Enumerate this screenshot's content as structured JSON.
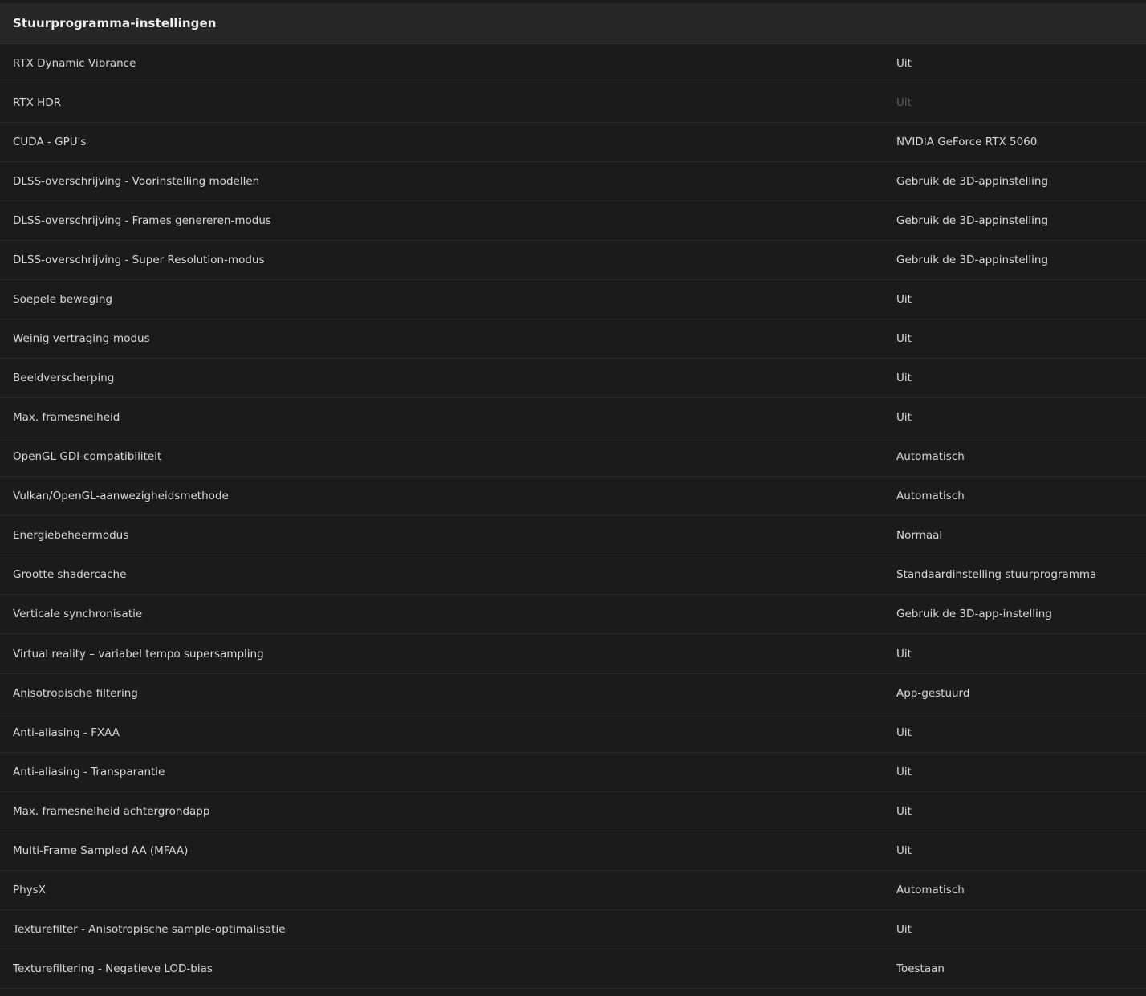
{
  "section": {
    "title": "Stuurprogramma-instellingen"
  },
  "rows": [
    {
      "label": "RTX Dynamic Vibrance",
      "value": "Uit"
    },
    {
      "label": "RTX HDR",
      "value": "Uit",
      "disabled": true
    },
    {
      "label": "CUDA - GPU's",
      "value": "NVIDIA GeForce RTX 5060"
    },
    {
      "label": "DLSS-overschrijving - Voorinstelling modellen",
      "value": "Gebruik de 3D-appinstelling"
    },
    {
      "label": "DLSS-overschrijving - Frames genereren-modus",
      "value": "Gebruik de 3D-appinstelling"
    },
    {
      "label": "DLSS-overschrijving - Super Resolution-modus",
      "value": "Gebruik de 3D-appinstelling"
    },
    {
      "label": "Soepele beweging",
      "value": "Uit"
    },
    {
      "label": "Weinig vertraging-modus",
      "value": "Uit"
    },
    {
      "label": "Beeldverscherping",
      "value": "Uit"
    },
    {
      "label": "Max. framesnelheid",
      "value": "Uit"
    },
    {
      "label": "OpenGL GDI-compatibiliteit",
      "value": "Automatisch"
    },
    {
      "label": "Vulkan/OpenGL-aanwezigheidsmethode",
      "value": "Automatisch"
    },
    {
      "label": "Energiebeheermodus",
      "value": "Normaal"
    },
    {
      "label": "Grootte shadercache",
      "value": "Standaardinstelling stuurprogramma"
    },
    {
      "label": "Verticale synchronisatie",
      "value": "Gebruik de 3D-app-instelling"
    },
    {
      "label": "Virtual reality – variabel tempo supersampling",
      "value": "Uit"
    },
    {
      "label": "Anisotropische filtering",
      "value": "App-gestuurd"
    },
    {
      "label": "Anti-aliasing - FXAA",
      "value": "Uit"
    },
    {
      "label": "Anti-aliasing - Transparantie",
      "value": "Uit"
    },
    {
      "label": "Max. framesnelheid achtergrondapp",
      "value": "Uit"
    },
    {
      "label": "Multi-Frame Sampled AA (MFAA)",
      "value": "Uit"
    },
    {
      "label": "PhysX",
      "value": "Automatisch"
    },
    {
      "label": "Texturefilter - Anisotropische sample-optimalisatie",
      "value": "Uit"
    },
    {
      "label": "Texturefiltering - Negatieve LOD-bias",
      "value": "Toestaan"
    }
  ]
}
